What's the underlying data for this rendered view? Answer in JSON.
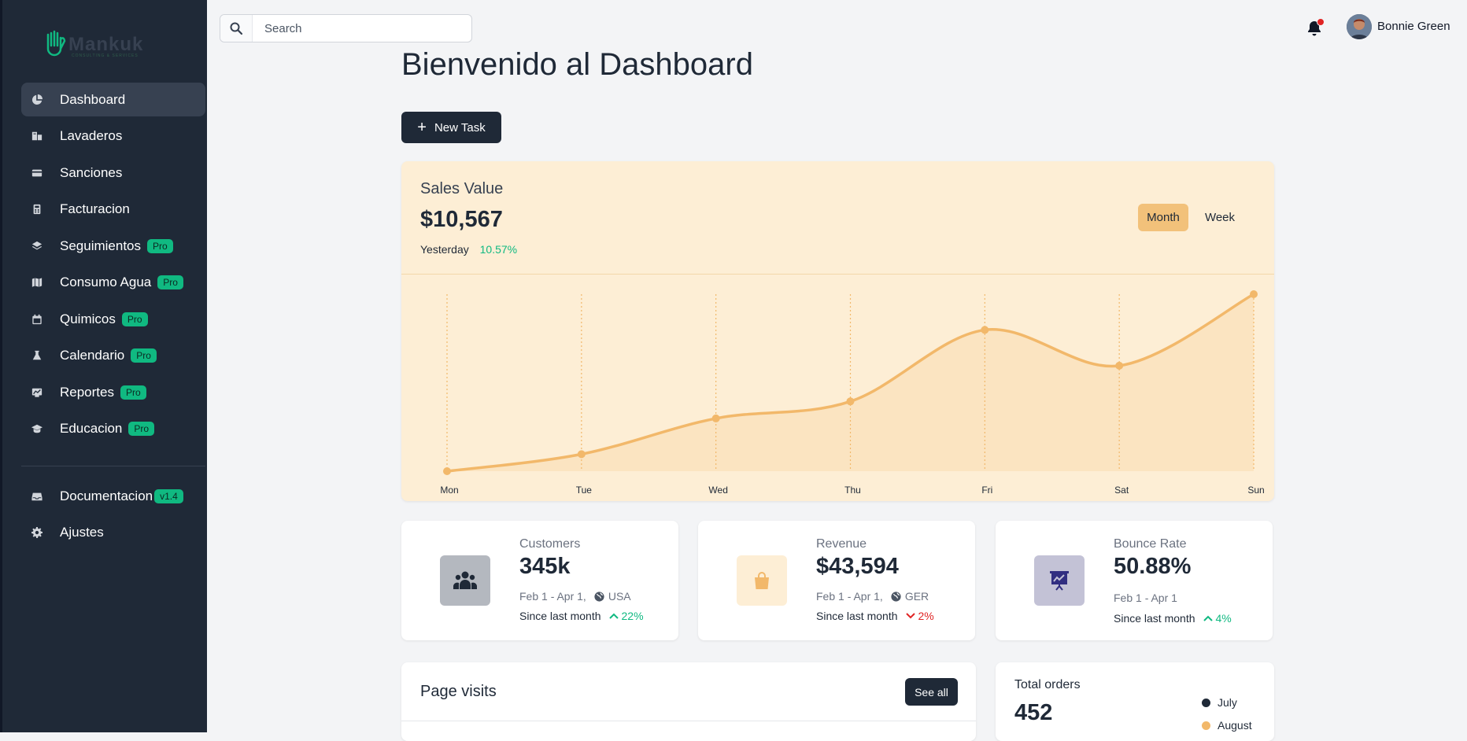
{
  "app": {
    "logo_text": "Mankuk",
    "logo_subtext": "CONSULTING & SERVICES"
  },
  "sidebar": {
    "items": [
      {
        "label": "Dashboard",
        "icon": "pie-chart-icon",
        "active": true,
        "badge": ""
      },
      {
        "label": "Lavaderos",
        "icon": "building-icon",
        "badge": ""
      },
      {
        "label": "Sanciones",
        "icon": "credit-card-icon",
        "badge": ""
      },
      {
        "label": "Facturacion",
        "icon": "calculator-icon",
        "badge": ""
      },
      {
        "label": "Seguimientos",
        "icon": "layers-icon",
        "badge": "Pro"
      },
      {
        "label": "Consumo Agua",
        "icon": "map-icon",
        "badge": "Pro"
      },
      {
        "label": "Quimicos",
        "icon": "calendar-icon",
        "badge": "Pro"
      },
      {
        "label": "Calendario",
        "icon": "beaker-icon",
        "badge": "Pro"
      },
      {
        "label": "Reportes",
        "icon": "chart-icon",
        "badge": "Pro"
      },
      {
        "label": "Educacion",
        "icon": "graduation-cap-icon",
        "badge": "Pro"
      }
    ],
    "secondary": [
      {
        "label": "Documentacion",
        "icon": "inbox-icon",
        "badge": "v1.4"
      },
      {
        "label": "Ajustes",
        "icon": "gear-icon",
        "badge": ""
      }
    ]
  },
  "topbar": {
    "search_placeholder": "Search",
    "user_name": "Bonnie Green"
  },
  "main": {
    "title": "Bienvenido al Dashboard",
    "new_task_label": "New Task"
  },
  "sales": {
    "title": "Sales Value",
    "value": "$10,567",
    "sub_label": "Yesterday",
    "sub_pct": "10.57%",
    "toggle_month": "Month",
    "toggle_week": "Week",
    "accent": "#f2b86a"
  },
  "chart_data": {
    "type": "area",
    "categories": [
      "Mon",
      "Tue",
      "Wed",
      "Thu",
      "Fri",
      "Sat",
      "Sun"
    ],
    "series": [
      {
        "values": [
          0,
          10,
          31,
          41,
          83,
          62,
          104
        ]
      }
    ],
    "ylim": [
      0,
      104
    ],
    "grid": "vertical dotted",
    "legend": "none"
  },
  "stats": [
    {
      "title": "Customers",
      "value": "345k",
      "period": "Feb 1 - Apr 1,",
      "region": "USA",
      "since": "Since last month",
      "change": "22%",
      "trend": "up",
      "icon": "users-icon",
      "icon_bg": "#b4b8bf"
    },
    {
      "title": "Revenue",
      "value": "$43,594",
      "period": "Feb 1 - Apr 1,",
      "region": "GER",
      "since": "Since last month",
      "change": "2%",
      "trend": "down",
      "icon": "shopping-bag-icon",
      "icon_bg": "#fdeed5"
    },
    {
      "title": "Bounce Rate",
      "value": "50.88%",
      "period": "Feb 1 - Apr 1",
      "region": "",
      "since": "Since last month",
      "change": "4%",
      "trend": "up",
      "icon": "presentation-chart-icon",
      "icon_bg": "#c3c2d6"
    }
  ],
  "page_visits": {
    "title": "Page visits",
    "see_all": "See all"
  },
  "orders": {
    "title": "Total orders",
    "value": "452",
    "legend": [
      {
        "label": "July",
        "color": "#1f2937"
      },
      {
        "label": "August",
        "color": "#f2b86a"
      }
    ]
  }
}
